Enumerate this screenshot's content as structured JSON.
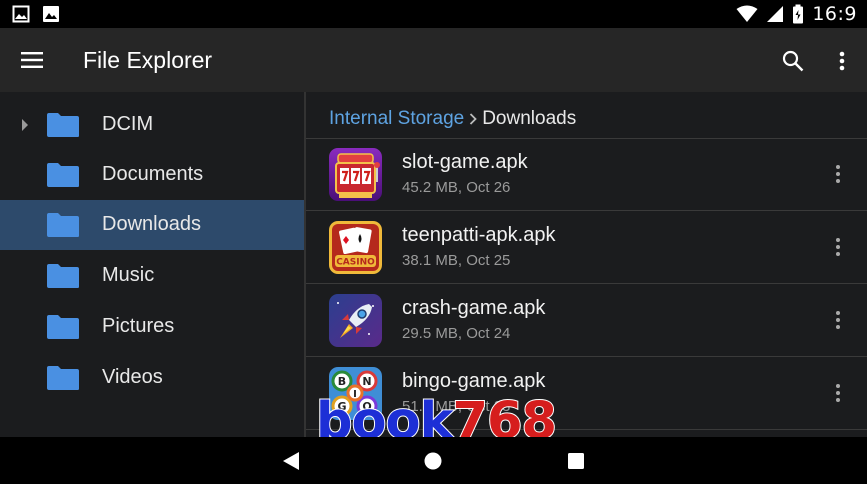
{
  "status_bar": {
    "time": "16:9",
    "left_icons": [
      "image-icon",
      "photo-icon"
    ],
    "right_icons": [
      "wifi-icon",
      "signal-icon",
      "battery-icon"
    ]
  },
  "toolbar": {
    "title": "File Explorer",
    "icons": [
      "menu-icon",
      "search-icon",
      "more-vert-icon"
    ]
  },
  "sidebar": {
    "items": [
      {
        "label": "DCIM",
        "expandable": true,
        "active": false
      },
      {
        "label": "Documents",
        "expandable": false,
        "active": false
      },
      {
        "label": "Downloads",
        "expandable": false,
        "active": true
      },
      {
        "label": "Music",
        "expandable": false,
        "active": false
      },
      {
        "label": "Pictures",
        "expandable": false,
        "active": false
      },
      {
        "label": "Videos",
        "expandable": false,
        "active": false
      }
    ]
  },
  "breadcrumb": {
    "root": "Internal Storage",
    "current": "Downloads"
  },
  "files": [
    {
      "name": "slot-game.apk",
      "meta": "45.2 MB, Oct 26",
      "icon": "slot-machine-icon"
    },
    {
      "name": "teenpatti-apk.apk",
      "meta": "38.1 MB, Oct 25",
      "icon": "casino-cards-icon"
    },
    {
      "name": "crash-game.apk",
      "meta": "29.5 MB, Oct 24",
      "icon": "rocket-icon"
    },
    {
      "name": "bingo-game.apk",
      "meta": "51.0 MB, Oct 23",
      "icon": "bingo-balls-icon"
    }
  ],
  "watermark": {
    "part1": "book",
    "part2": "768"
  },
  "colors": {
    "accent": "#5ea3e2",
    "folder": "#4a90e2",
    "selected_bg": "#2d4a6b",
    "toolbar_bg": "#262626",
    "panel_bg": "#1b1c1e"
  }
}
